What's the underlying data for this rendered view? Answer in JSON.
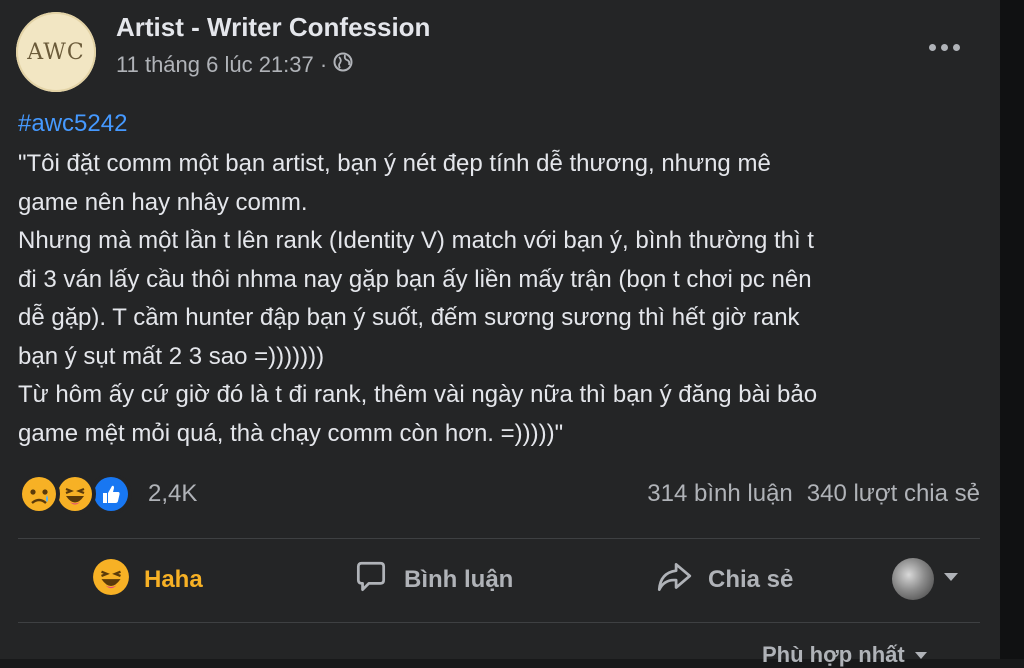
{
  "post": {
    "page_name": "Artist - Writer Confession",
    "avatar_text": "AWC",
    "timestamp": "11 tháng 6 lúc 21:37 ·",
    "hashtag": "#awc5242",
    "text_lines": [
      "\"Tôi đặt comm một bạn artist, bạn ý nét đẹp tính dễ thương, nhưng mê",
      "game nên hay nhây comm.",
      "Nhưng mà một lần t lên rank (Identity V) match với bạn ý, bình thường thì t",
      "đi 3 ván lấy cầu thôi nhma nay gặp bạn ấy liền mấy trận (bọn t chơi pc nên",
      "dễ gặp). T cầm hunter đập bạn ý suốt, đếm sương sương thì hết giờ rank",
      "bạn ý sụt mất 2 3 sao =)))))))",
      "Từ hôm ấy cứ giờ đó là t đi rank, thêm vài ngày nữa thì bạn ý đăng bài bảo",
      "game mệt mỏi quá, thà chạy comm còn hơn. =)))))\""
    ]
  },
  "reactions": {
    "icons": [
      "sad-icon",
      "haha-icon",
      "like-icon"
    ],
    "count": "2,4K"
  },
  "stats": {
    "comments": "314 bình luận",
    "shares": "340 lượt chia sẻ"
  },
  "actions": {
    "haha": "Haha",
    "comment": "Bình luận",
    "share": "Chia sẻ"
  },
  "sort": {
    "label": "Phù hợp nhất"
  },
  "colors": {
    "background": "#242526",
    "hashtag": "#4599ff",
    "haha_active": "#f7b125",
    "secondary_text": "#b0b3b8"
  }
}
